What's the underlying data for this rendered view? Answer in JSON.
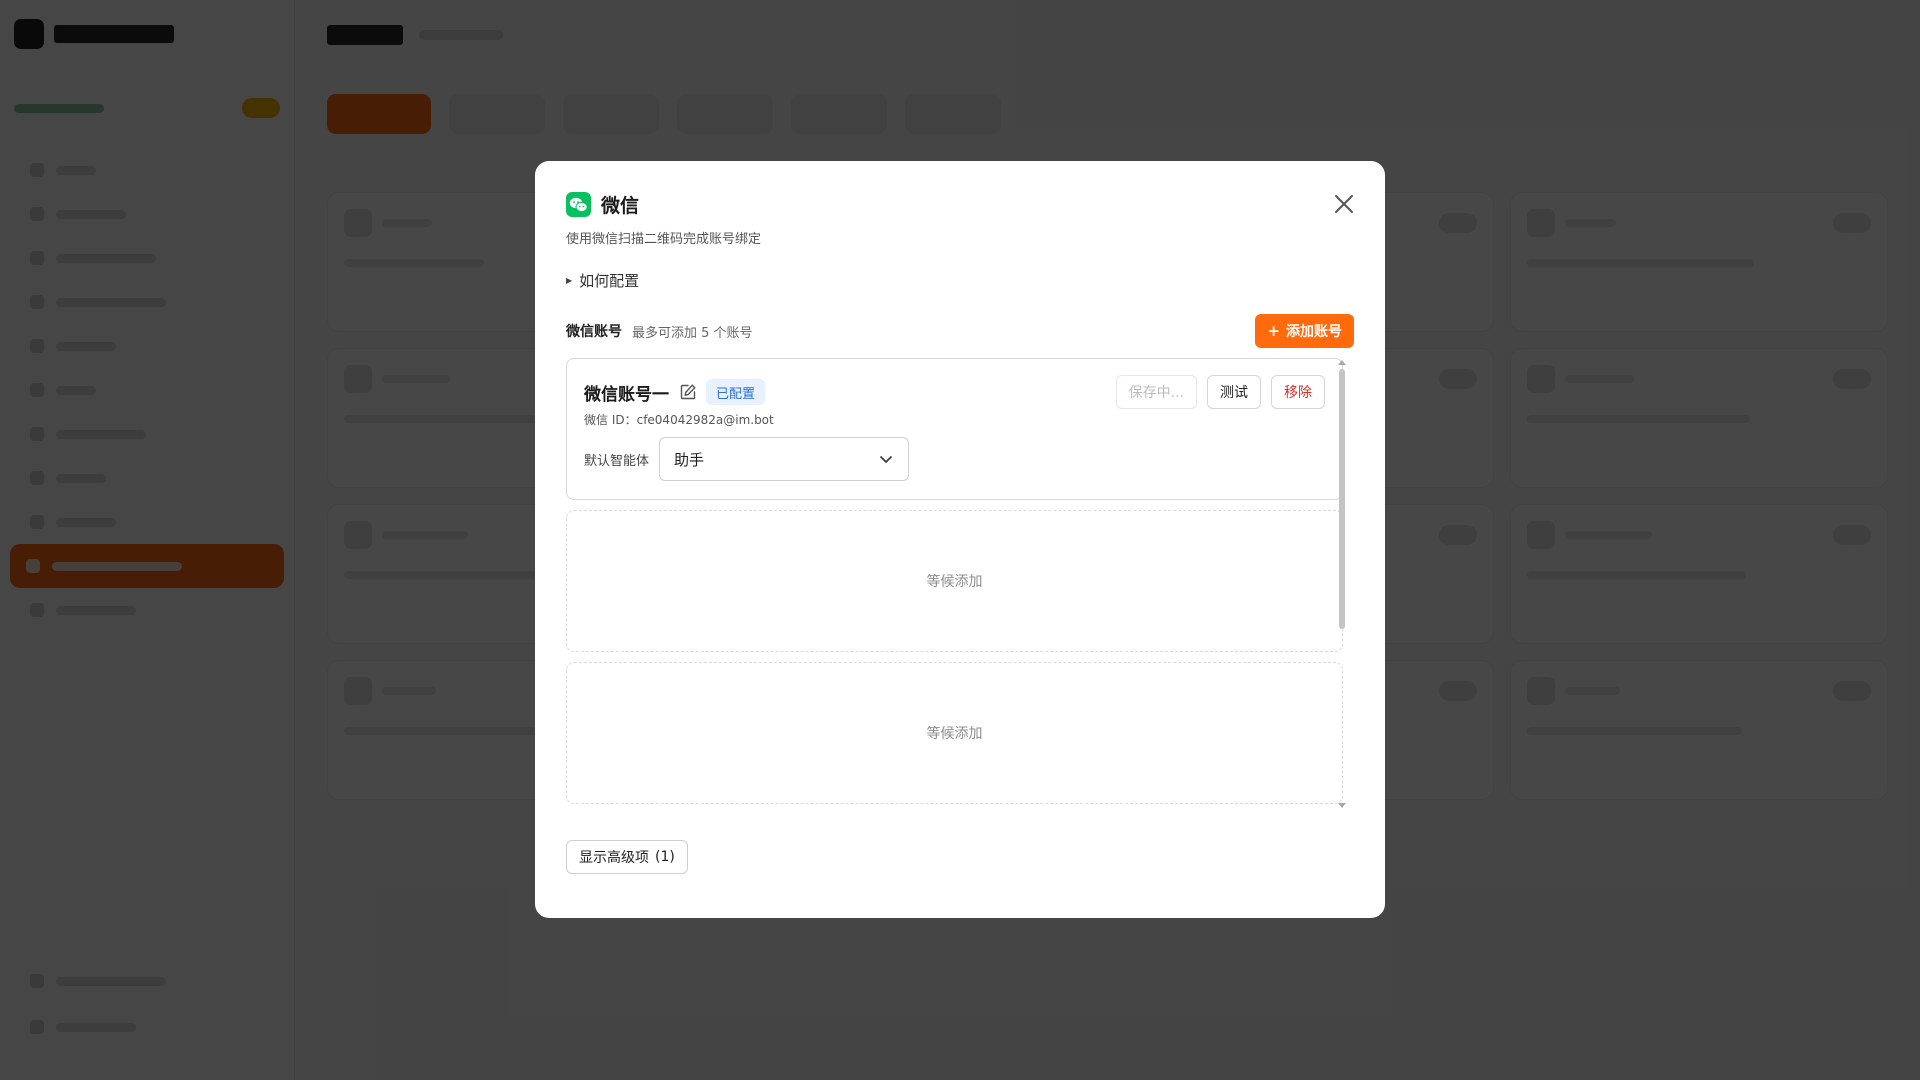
{
  "background": {
    "nav_count": 11,
    "active_nav": 9
  },
  "modal": {
    "icon": "wechat-icon",
    "title": "微信",
    "description": "使用微信扫描二维码完成账号绑定",
    "howto_label": "如何配置",
    "accounts_title": "微信账号",
    "accounts_hint": "最多可添加 5 个账号",
    "add_button": "添加账号",
    "accounts": [
      {
        "name": "微信账号一",
        "status_badge": "已配置",
        "id_text": "微信 ID：cfe04042982a@im.bot",
        "save_button": "保存中...",
        "test_button": "测试",
        "remove_button": "移除",
        "agent_label": "默认智能体",
        "agent_value": "助手"
      }
    ],
    "placeholders": [
      {
        "label": "等候添加"
      },
      {
        "label": "等候添加"
      }
    ],
    "advanced_label": "显示高级项",
    "advanced_count": "(1)"
  },
  "colors": {
    "accent": "#ff6a0c",
    "wechat_green": "#07c160",
    "badge_bg": "#e8f1ff",
    "badge_text": "#2f6fd6",
    "danger": "#d9302c"
  }
}
